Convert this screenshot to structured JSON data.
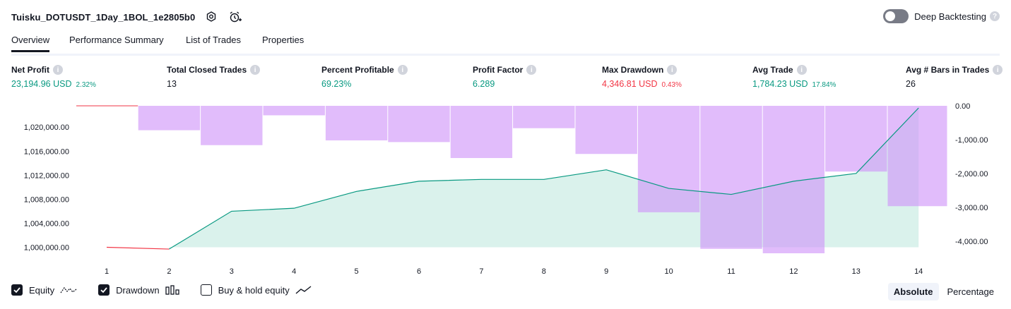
{
  "header": {
    "strategy_title": "Tuisku_DOTUSDT_1Day_1BOL_1e2805b0",
    "deep_backtesting_label": "Deep Backtesting"
  },
  "tabs": [
    {
      "label": "Overview",
      "active": true
    },
    {
      "label": "Performance Summary",
      "active": false
    },
    {
      "label": "List of Trades",
      "active": false
    },
    {
      "label": "Properties",
      "active": false
    }
  ],
  "metrics": [
    {
      "label": "Net Profit",
      "value": "23,194.96 USD",
      "pct": "2.32%",
      "tone": "pos"
    },
    {
      "label": "Total Closed Trades",
      "value": "13",
      "pct": "",
      "tone": "plain"
    },
    {
      "label": "Percent Profitable",
      "value": "69.23%",
      "pct": "",
      "tone": "pos"
    },
    {
      "label": "Profit Factor",
      "value": "6.289",
      "pct": "",
      "tone": "pos"
    },
    {
      "label": "Max Drawdown",
      "value": "4,346.81 USD",
      "pct": "0.43%",
      "tone": "neg"
    },
    {
      "label": "Avg Trade",
      "value": "1,784.23 USD",
      "pct": "17.84%",
      "tone": "pos"
    },
    {
      "label": "Avg # Bars in Trades",
      "value": "26",
      "pct": "",
      "tone": "plain"
    }
  ],
  "chart_data": {
    "type": "line",
    "x": [
      1,
      2,
      3,
      4,
      5,
      6,
      7,
      8,
      9,
      10,
      11,
      12,
      13,
      14
    ],
    "series": [
      {
        "name": "Equity",
        "axis": "left",
        "color": "#089981",
        "loss_color": "#f23645",
        "values": [
          1000000,
          999700,
          1006000,
          1006500,
          1009300,
          1011000,
          1011300,
          1011300,
          1012900,
          1009800,
          1008800,
          1011000,
          1012300,
          1023200
        ]
      },
      {
        "name": "Drawdown",
        "axis": "right",
        "color": "#ce93f8",
        "values": [
          0,
          -720,
          -1160,
          -280,
          -1020,
          -1070,
          -1540,
          -660,
          -1420,
          -3140,
          -4220,
          -4350,
          -1940,
          -2960
        ]
      }
    ],
    "ylim_left": [
      999000,
      1023200
    ],
    "yticks_left": [
      "1,000,000.00",
      "1,004,000.00",
      "1,008,000.00",
      "1,012,000.00",
      "1,016,000.00",
      "1,020,000.00"
    ],
    "yticks_left_values": [
      1000000,
      1004000,
      1008000,
      1012000,
      1016000,
      1020000
    ],
    "ylim_right": [
      -4350,
      0
    ],
    "yticks_right": [
      "0.00",
      "-1,000.00",
      "-2,000.00",
      "-3,000.00",
      "-4,000.00"
    ],
    "yticks_right_values": [
      0,
      -1000,
      -2000,
      -3000,
      -4000
    ],
    "xticks": [
      "1",
      "2",
      "3",
      "4",
      "5",
      "6",
      "7",
      "8",
      "9",
      "10",
      "11",
      "12",
      "13",
      "14"
    ]
  },
  "legend": {
    "equity_label": "Equity",
    "drawdown_label": "Drawdown",
    "buyhold_label": "Buy & hold equity",
    "equity_checked": true,
    "drawdown_checked": true,
    "buyhold_checked": false
  },
  "scale_toggle": {
    "absolute_label": "Absolute",
    "percentage_label": "Percentage",
    "active": "absolute"
  },
  "colors": {
    "accent": "#131722",
    "positive": "#089981",
    "negative": "#f23645",
    "drawdown": "#ce93f8"
  }
}
